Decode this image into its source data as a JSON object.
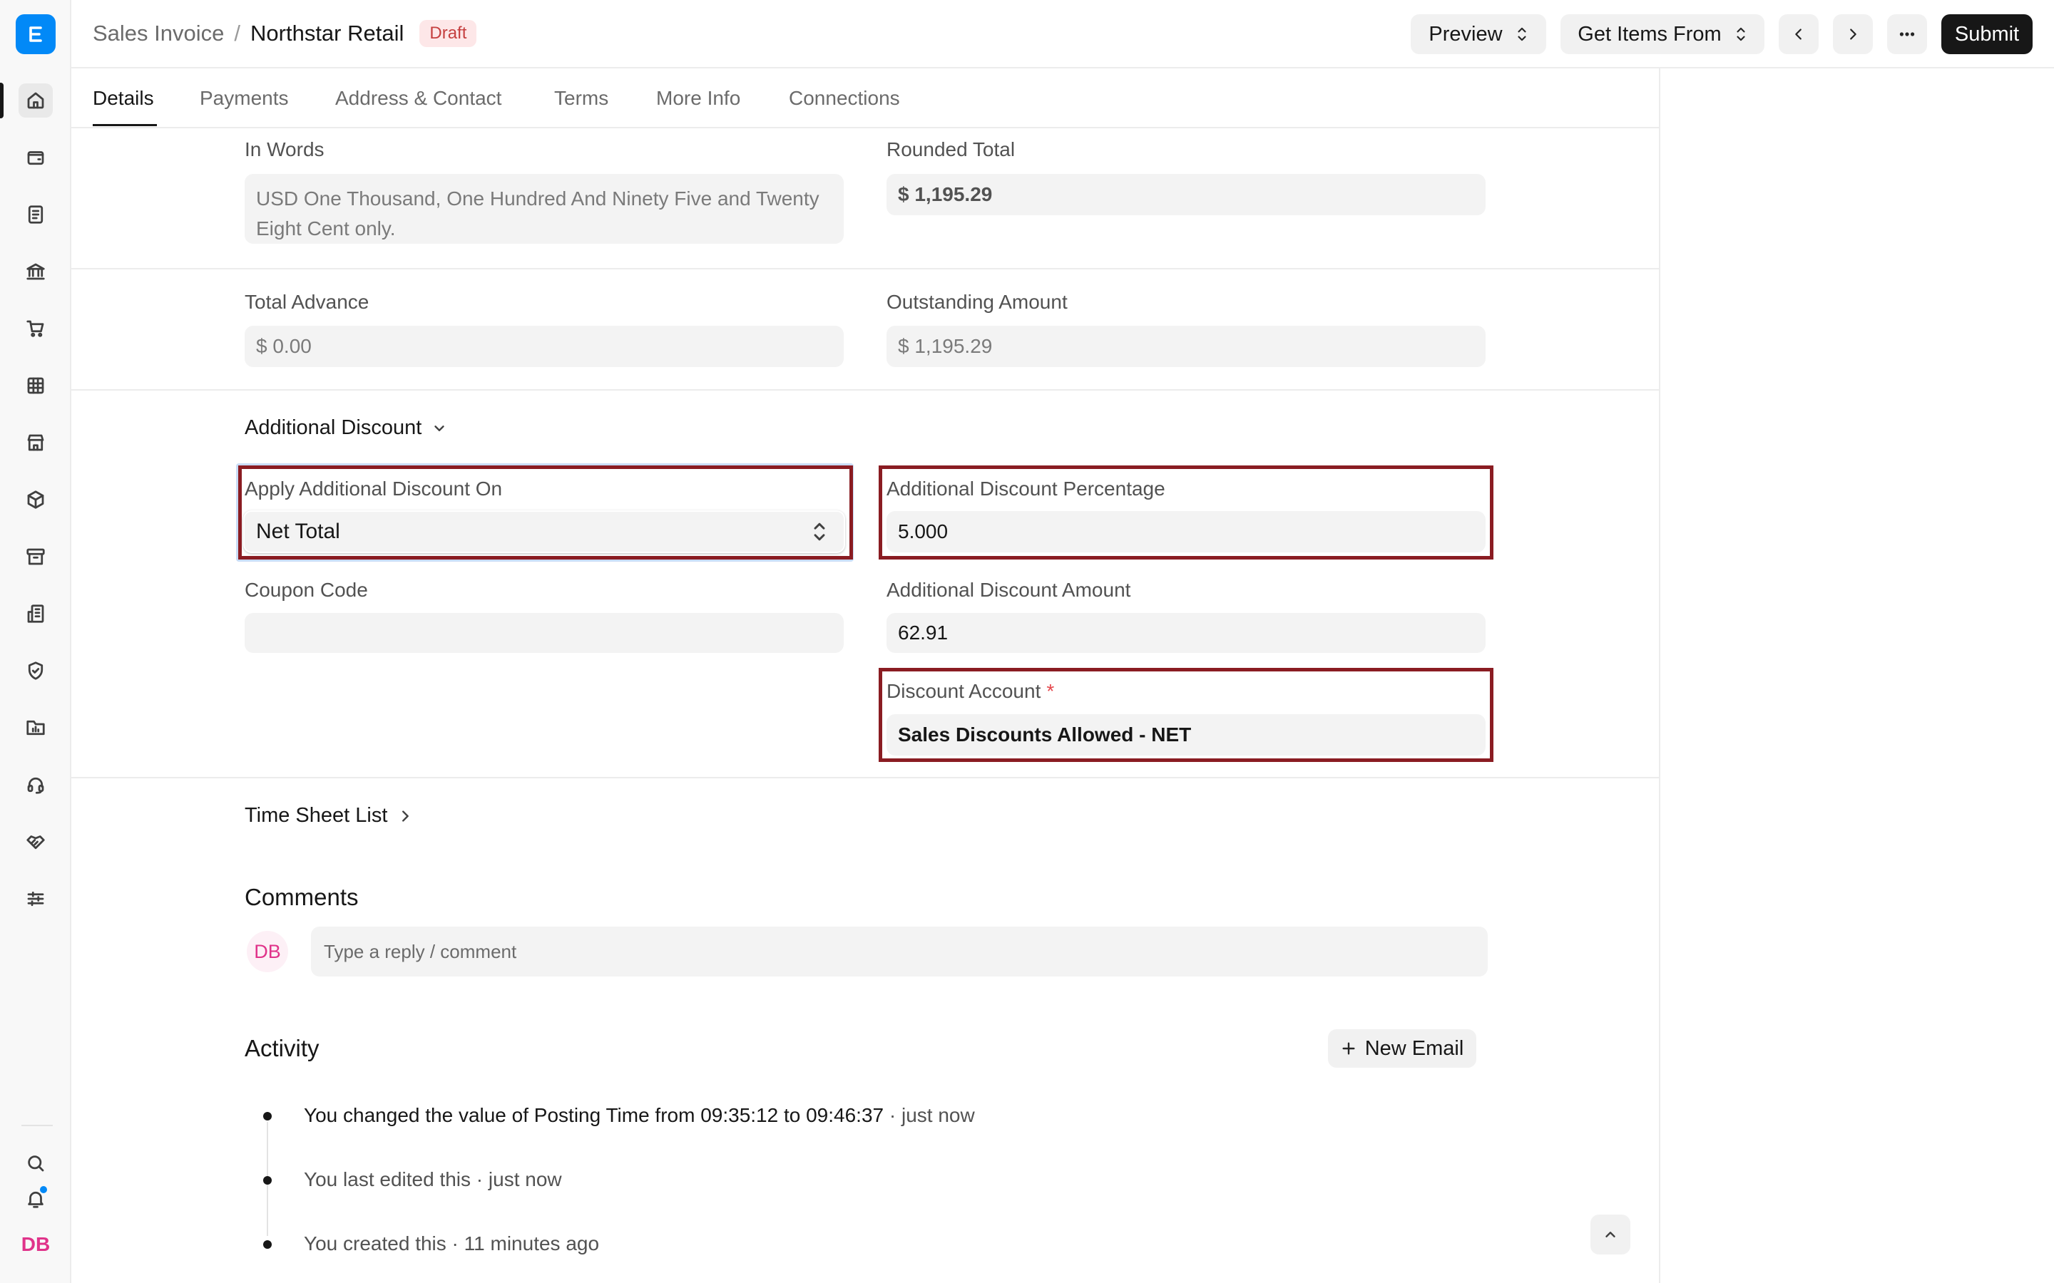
{
  "header": {
    "breadcrumb_parent": "Sales Invoice",
    "breadcrumb_separator": "/",
    "title": "Northstar Retail",
    "status_badge": "Draft",
    "preview_label": "Preview",
    "get_items_label": "Get Items From",
    "submit_label": "Submit"
  },
  "sidebar": {
    "icons": [
      "home-icon",
      "wallet-icon",
      "document-icon",
      "bank-icon",
      "cart-icon",
      "table-icon",
      "store-icon",
      "package-icon",
      "archive-icon",
      "building-icon",
      "shield-icon",
      "folder-chart-icon",
      "headset-icon",
      "handshake-icon",
      "sliders-icon"
    ],
    "active_item": "home-icon",
    "bottom_icons": [
      "search-icon",
      "bell-icon"
    ],
    "user_initials": "DB"
  },
  "tabs": [
    "Details",
    "Payments",
    "Address & Contact",
    "Terms",
    "More Info",
    "Connections"
  ],
  "active_tab": "Details",
  "totals": {
    "in_words_label": "In Words",
    "in_words_value": "USD One Thousand, One Hundred And Ninety Five and Twenty Eight Cent only.",
    "rounded_total_label": "Rounded Total",
    "rounded_total_value": "$ 1,195.29",
    "total_advance_label": "Total Advance",
    "total_advance_value": "$ 0.00",
    "outstanding_label": "Outstanding Amount",
    "outstanding_value": "$ 1,195.29"
  },
  "discount": {
    "section_title": "Additional Discount",
    "apply_on_label": "Apply Additional Discount On",
    "apply_on_value": "Net Total",
    "percentage_label": "Additional Discount Percentage",
    "percentage_value": "5.000",
    "coupon_label": "Coupon Code",
    "coupon_value": "",
    "amount_label": "Additional Discount Amount",
    "amount_value": "62.91",
    "account_label": "Discount Account",
    "account_required_mark": "*",
    "account_value": "Sales Discounts Allowed - NET"
  },
  "timesheet": {
    "title": "Time Sheet List"
  },
  "comments": {
    "title": "Comments",
    "avatar_initials": "DB",
    "placeholder": "Type a reply / comment"
  },
  "activity": {
    "title": "Activity",
    "new_email_label": "New Email",
    "items": [
      {
        "text": "You changed the value of Posting Time from 09:35:12 to 09:46:37",
        "time": " · just now"
      },
      {
        "text": "You last edited this",
        "time": " · just now"
      },
      {
        "text": "You created this",
        "time": " · 11 minutes ago"
      }
    ]
  },
  "colors": {
    "brand": "#0289f7",
    "highlight_border": "#8a1c22",
    "draft_badge_bg": "#fde7e8",
    "draft_badge_text": "#c53f3f",
    "avatar_pink": "#e0338a"
  }
}
